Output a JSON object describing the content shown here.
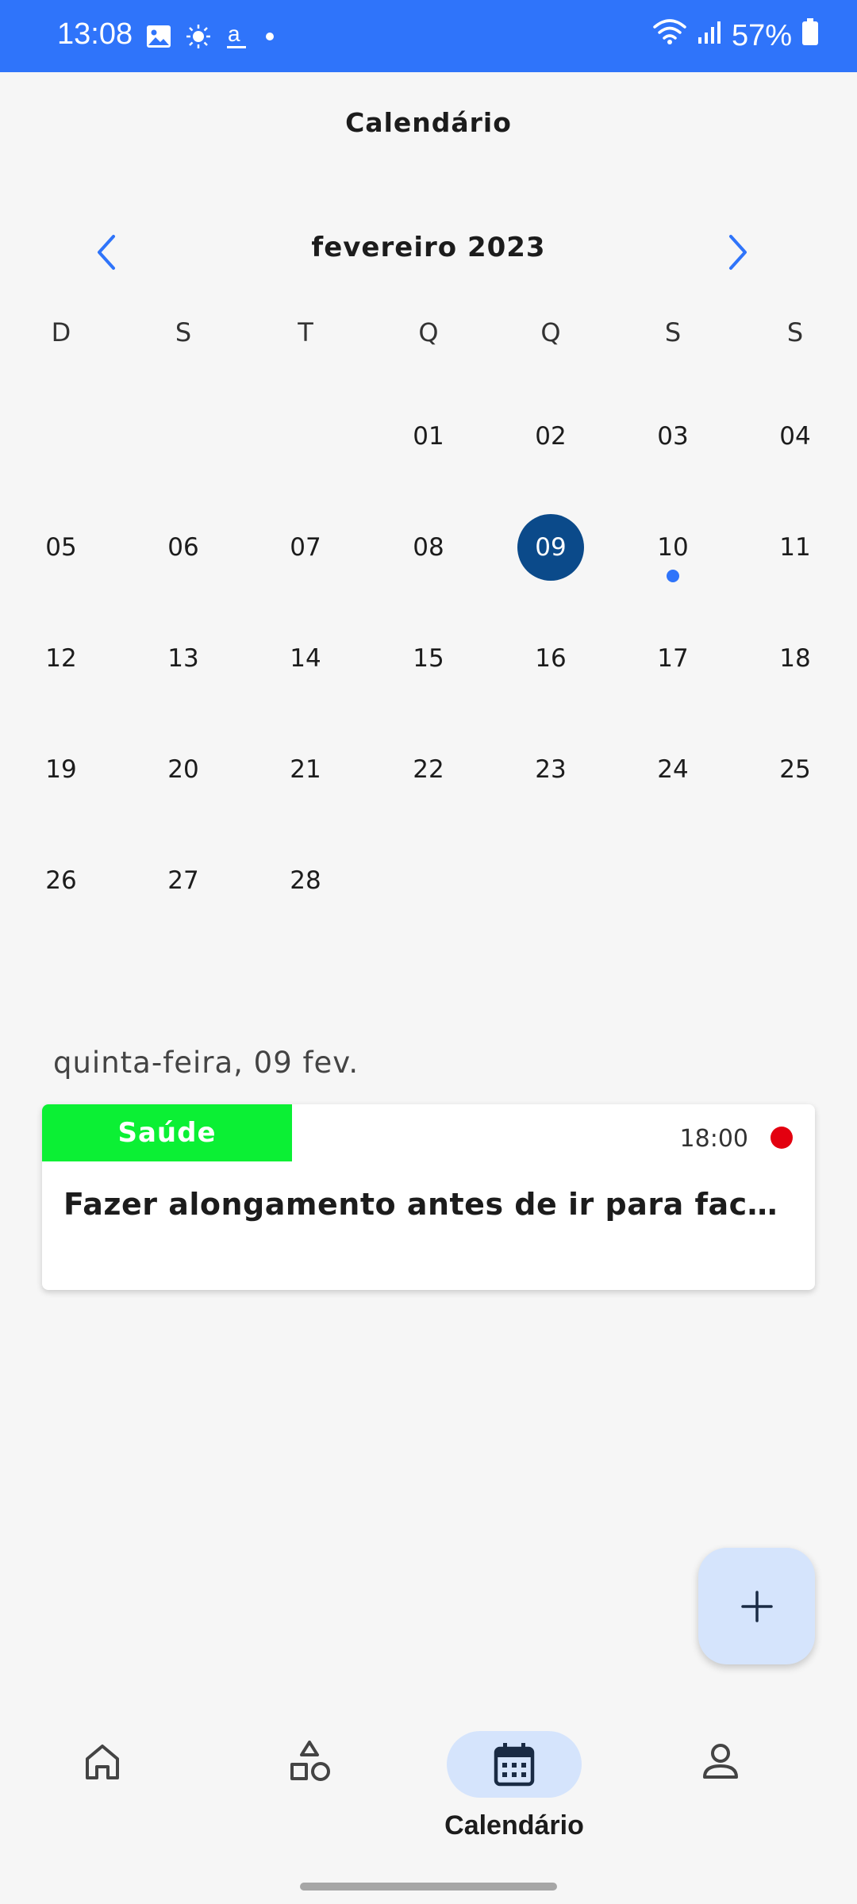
{
  "status_bar": {
    "time": "13:08",
    "battery": "57%",
    "icons": [
      "image-icon",
      "brightness-icon",
      "amazon-a-icon",
      "dot-icon",
      "wifi-icon",
      "signal-icon",
      "battery-icon"
    ]
  },
  "header": {
    "title": "Calendário"
  },
  "calendar": {
    "month_label": "fevereiro 2023",
    "weekdays": [
      "D",
      "S",
      "T",
      "Q",
      "Q",
      "S",
      "S"
    ],
    "weeks": [
      [
        "",
        "",
        "",
        "01",
        "02",
        "03",
        "04"
      ],
      [
        "05",
        "06",
        "07",
        "08",
        "09",
        "10",
        "11"
      ],
      [
        "12",
        "13",
        "14",
        "15",
        "16",
        "17",
        "18"
      ],
      [
        "19",
        "20",
        "21",
        "22",
        "23",
        "24",
        "25"
      ],
      [
        "26",
        "27",
        "28",
        "",
        "",
        "",
        ""
      ]
    ],
    "selected_day": "09",
    "days_with_events": [
      "10"
    ]
  },
  "selected_date_label": "quinta-feira, 09 fev.",
  "tasks": [
    {
      "category": "Saúde",
      "category_color": "#0bf034",
      "time": "18:00",
      "priority_color": "#e3000f",
      "title": "Fazer alongamento antes de ir para faculdade"
    }
  ],
  "fab": {
    "icon": "plus-icon"
  },
  "bottom_nav": {
    "items": [
      {
        "icon": "home-icon",
        "label": ""
      },
      {
        "icon": "categories-icon",
        "label": ""
      },
      {
        "icon": "calendar-icon",
        "label": "Calendário",
        "active": true
      },
      {
        "icon": "profile-icon",
        "label": ""
      }
    ]
  },
  "colors": {
    "accent": "#2f74fa",
    "selected_day": "#0b4a8a",
    "active_pill": "#d5e4fc",
    "background": "#f6f6f6"
  }
}
